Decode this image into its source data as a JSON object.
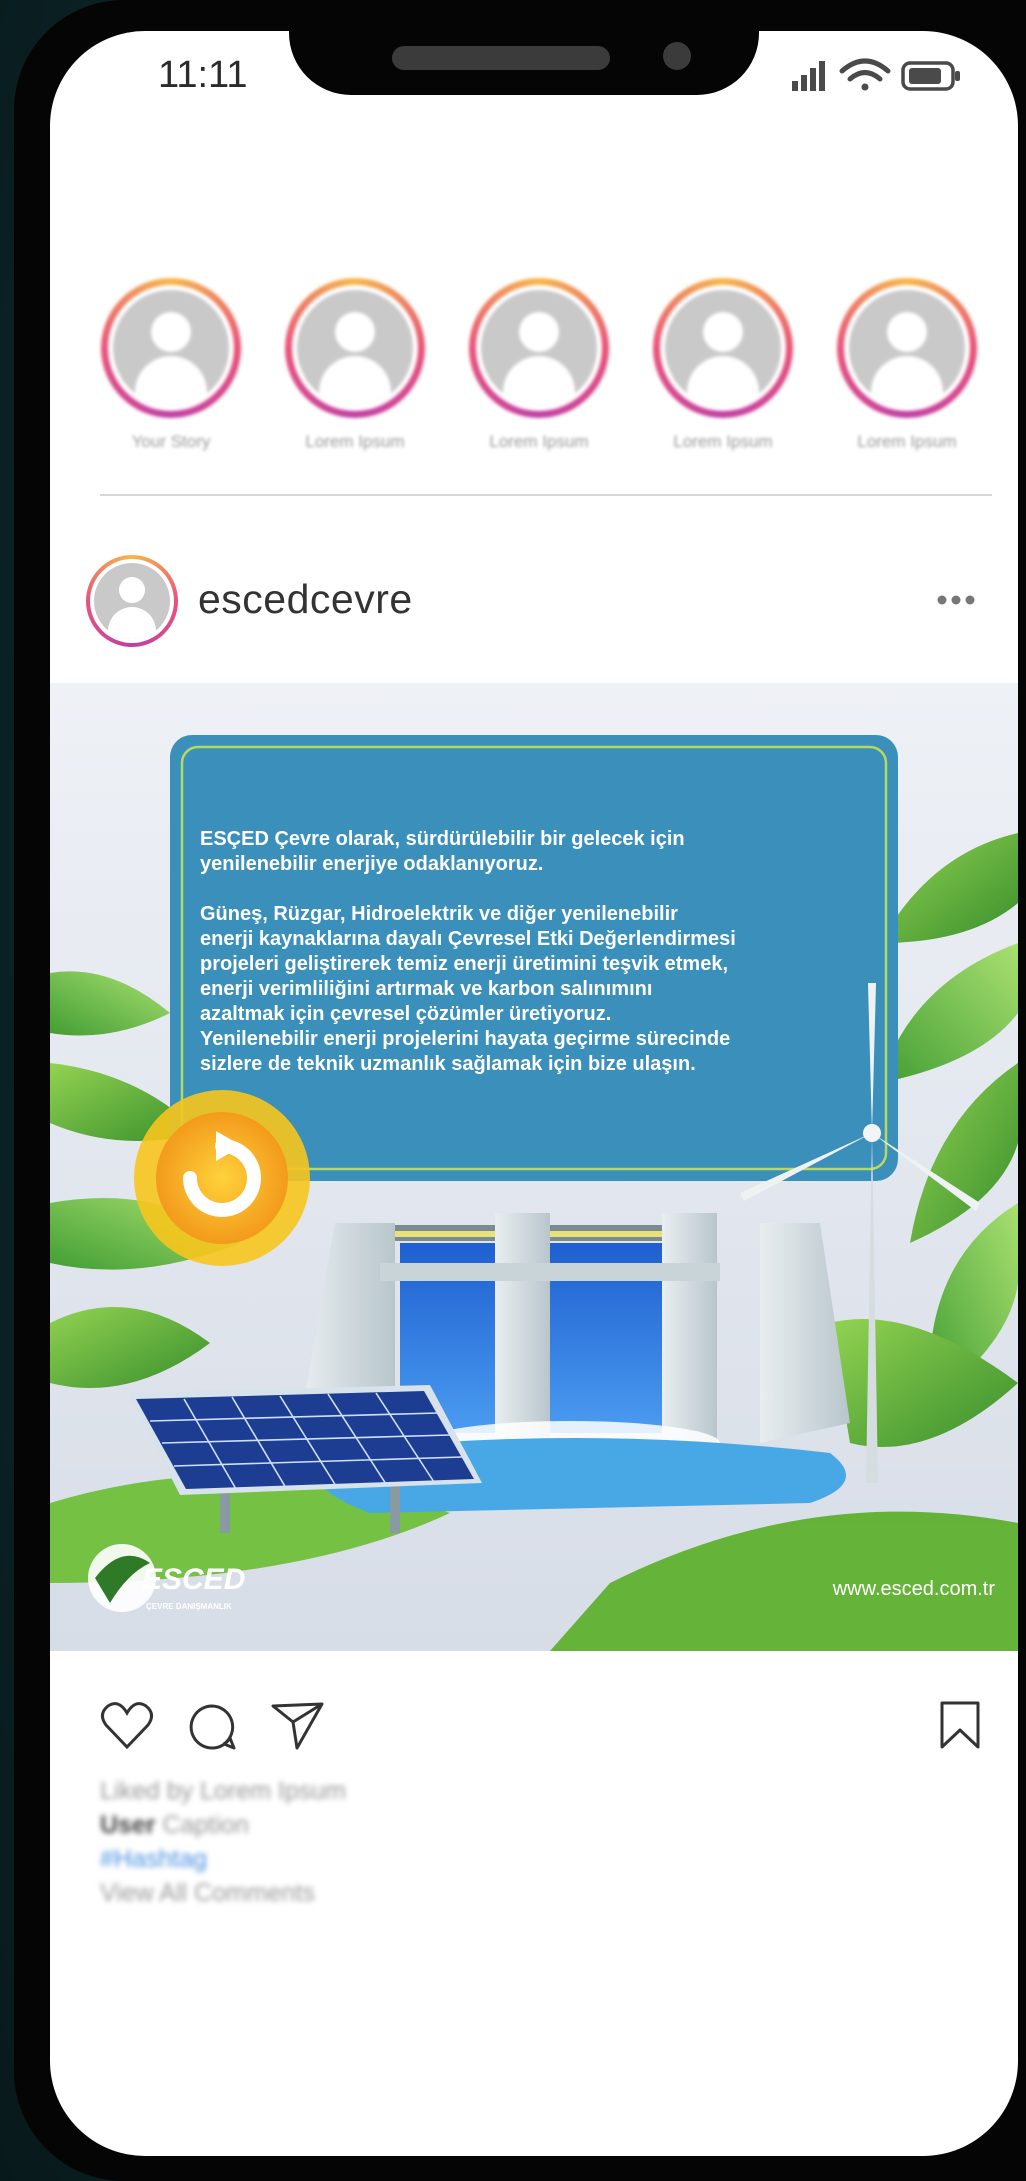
{
  "status_bar": {
    "time": "11:11"
  },
  "stories": [
    {
      "label": "Your Story"
    },
    {
      "label": "Lorem Ipsum"
    },
    {
      "label": "Lorem Ipsum"
    },
    {
      "label": "Lorem Ipsum"
    },
    {
      "label": "Lorem Ipsum"
    }
  ],
  "post": {
    "username": "escedcevre",
    "image": {
      "board_text_1": "ESÇED Çevre olarak, sürdürülebilir bir gelecek için",
      "board_text_2": "yenilenebilir enerjiye odaklanıyoruz.",
      "board_text_3": "Güneş, Rüzgar, Hidroelektrik ve diğer yenilenebilir",
      "board_text_4": "enerji kaynaklarına dayalı Çevresel Etki Değerlendirmesi",
      "board_text_5": "projeleri geliştirerek temiz enerji üretimini teşvik etmek,",
      "board_text_6": "enerji verimliliğini artırmak ve karbon salınımını",
      "board_text_7": "azaltmak için çevresel çözümler üretiyoruz.",
      "board_text_8": "Yenilenebilir enerji projelerini hayata geçirme sürecinde",
      "board_text_9": "sizlere de teknik uzmanlık sağlamak için bize ulaşın.",
      "logo_text": "ESCED",
      "logo_subtext": "ÇEVRE DANIŞMANLIK",
      "website": "www.esced.com.tr"
    },
    "caption": {
      "liked_by": "Liked by Lorem Ipsum",
      "user": "User",
      "caption_text": "Caption",
      "hashtag": "#Hashtag",
      "view_comments": "View All Comments"
    }
  },
  "colors": {
    "background": "#0d2b2d",
    "board_blue": "#3a8fbb",
    "story_ring_start": "#f6b74a",
    "story_ring_end": "#c13fa5",
    "hashtag": "#4a8fe0"
  }
}
